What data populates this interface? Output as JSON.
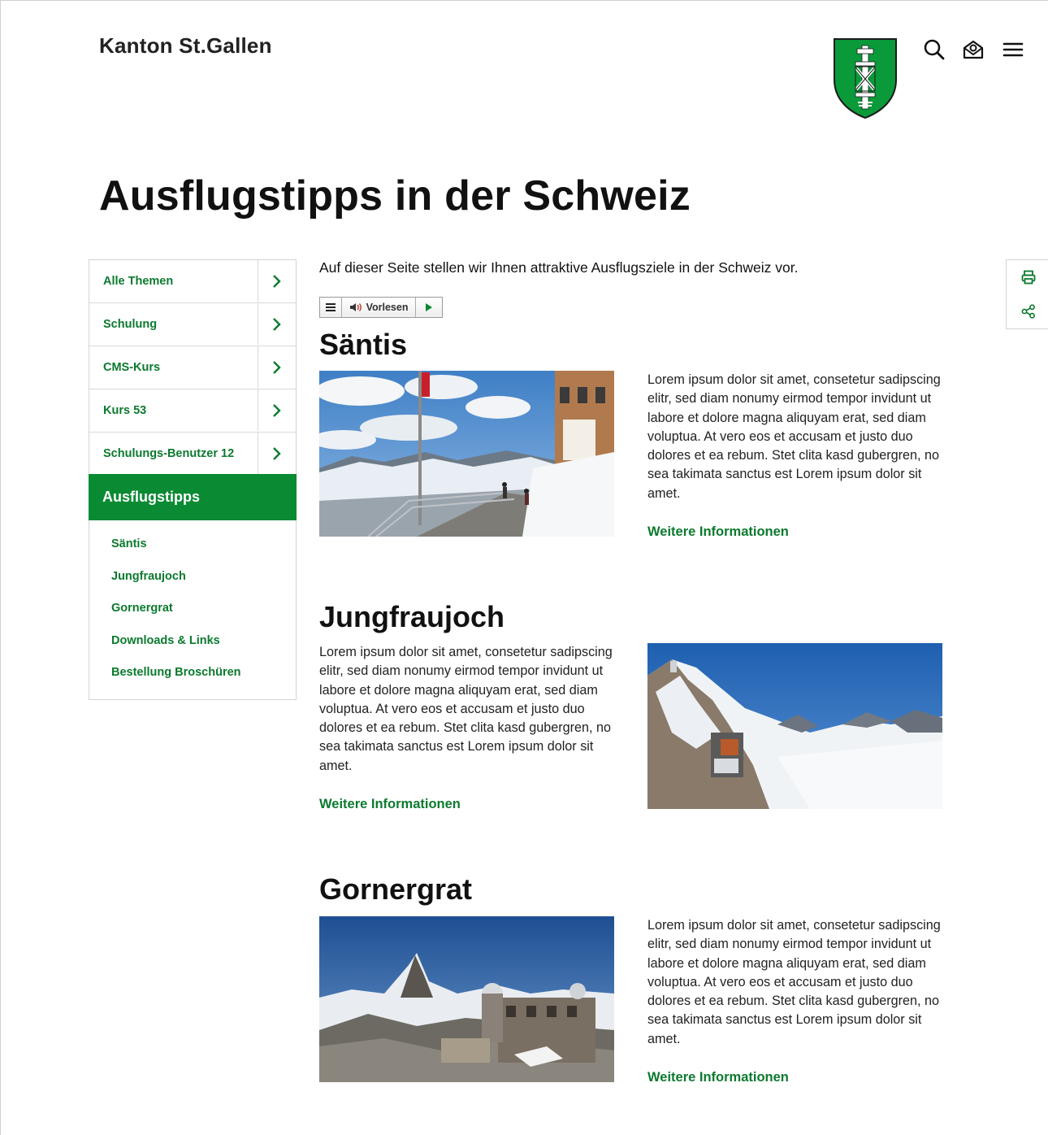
{
  "header": {
    "brand": "Kanton St.Gallen",
    "icons": [
      "search-icon",
      "login-icon",
      "menu-icon"
    ]
  },
  "page": {
    "title": "Ausflugstipps in der Schweiz",
    "intro": "Auf dieser Seite stellen wir Ihnen attraktive Ausflugsziele in der Schweiz vor."
  },
  "sidebar": {
    "items": [
      {
        "label": "Alle Themen"
      },
      {
        "label": "Schulung"
      },
      {
        "label": "CMS-Kurs"
      },
      {
        "label": "Kurs 53"
      },
      {
        "label": "Schulungs-Benutzer 12"
      }
    ],
    "active": "Ausflugstipps",
    "subitems": [
      {
        "label": "Säntis"
      },
      {
        "label": "Jungfraujoch"
      },
      {
        "label": "Gornergrat"
      },
      {
        "label": "Downloads & Links"
      },
      {
        "label": "Bestellung Broschüren"
      }
    ]
  },
  "readspeaker": {
    "label": "Vorlesen"
  },
  "sections": [
    {
      "title": "Säntis",
      "text": "Lorem ipsum dolor sit amet, consetetur sadipscing elitr, sed diam nonumy eirmod tempor invidunt ut labore et dolore magna aliquyam erat, sed diam voluptua. At vero eos et accusam et justo duo dolores et ea rebum. Stet clita kasd gubergren, no sea takimata sanctus est Lorem ipsum dolor sit amet.",
      "link": "Weitere Informationen"
    },
    {
      "title": "Jungfraujoch",
      "text": "Lorem ipsum dolor sit amet, consetetur sadipscing elitr, sed diam nonumy eirmod tempor invidunt ut labore et dolore magna aliquyam erat, sed diam voluptua. At vero eos et accusam et justo duo dolores et ea rebum. Stet clita kasd gubergren, no sea takimata sanctus est Lorem ipsum dolor sit amet.",
      "link": "Weitere Informationen"
    },
    {
      "title": "Gornergrat",
      "text": "Lorem ipsum dolor sit amet, consetetur sadipscing elitr, sed diam nonumy eirmod tempor invidunt ut labore et dolore magna aliquyam erat, sed diam voluptua. At vero eos et accusam et justo duo dolores et ea rebum. Stet clita kasd gubergren, no sea takimata sanctus est Lorem ipsum dolor sit amet.",
      "link": "Weitere Informationen"
    }
  ],
  "tools": [
    "print-icon",
    "share-icon"
  ],
  "colors": {
    "brand_green": "#0a8a33",
    "link_green": "#0b7a2e"
  }
}
